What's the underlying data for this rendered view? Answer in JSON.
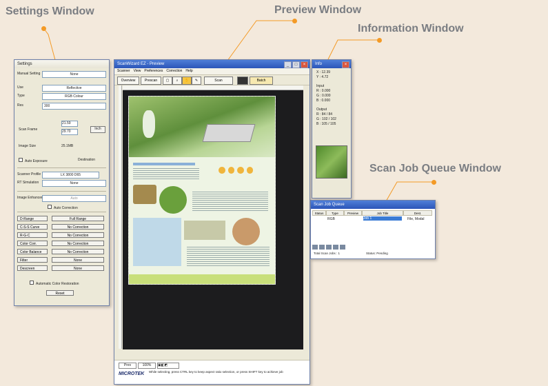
{
  "callouts": {
    "settings": "Settings Window",
    "preview": "Preview Window",
    "information": "Information Window",
    "queue": "Scan Job Queue Window"
  },
  "colors": {
    "accent": "#f39a26",
    "titlebar": "#2b55b8",
    "background": "#f3e9dc"
  },
  "settings_window": {
    "title": "Settings",
    "fields": [
      {
        "label": "Manual Setting",
        "value": "None"
      },
      {
        "label": "Use",
        "value": "Reflective"
      },
      {
        "label": "Type",
        "value": "RGB Colour"
      },
      {
        "label": "Res",
        "value": "300"
      }
    ],
    "scan_frame_label": "Scan Frame",
    "scan_frame_w": "21.59",
    "scan_frame_h": "29.70",
    "unit": "Inch",
    "image_size_label": "Image Size",
    "image_size_value": "25.1MB",
    "auto_exposure": "Auto Exposure",
    "tone_label": "Destination",
    "scanner_profile_label": "Scanner Profile",
    "scanner_profile_value": "LX 3800 D65",
    "rt_simulation": "RT Simulation",
    "rt_value": "None",
    "imagetype_label": "Image Enhancer",
    "imagetype_value": "Auto",
    "auto_correction": "Auto Correction",
    "buttons": [
      {
        "label": "D-Range",
        "value": "Full Range"
      },
      {
        "label": "C-S-S Curve",
        "value": "No Correction"
      },
      {
        "label": "R-G-C",
        "value": "No Correction"
      },
      {
        "label": "Color Corr.",
        "value": "No Correction"
      },
      {
        "label": "Color Balance",
        "value": "No Correction"
      },
      {
        "label": "Filter",
        "value": "None"
      },
      {
        "label": "Descreen",
        "value": "None"
      }
    ],
    "auto_checkbox": "Automatic Color Restoration",
    "reset": "Reset"
  },
  "preview_window": {
    "title": "ScanWizard EZ - Preview",
    "menu": [
      "Scanner",
      "View",
      "Preferences",
      "Correction",
      "Help"
    ],
    "toolbar": {
      "overview": "Overview",
      "prescan": "Prescan",
      "scan": "Scan",
      "batch": "Batch"
    },
    "status_left": "Prev",
    "status_zoom": "100%",
    "status_hint": "While selecting, press CTRL key to keep aspect ratio selection, or press SHIFT key to achieve job",
    "logo": "MICROTEK"
  },
  "info_window": {
    "title": "Info",
    "coords": [
      "X : 12.39",
      "Y : 4.72"
    ],
    "input_label": "Input",
    "input_vals": [
      "R : 0.000",
      "G : 0.000",
      "B : 0.000"
    ],
    "output_label": "Output",
    "output_vals": [
      "R : 84  /  84",
      "G : 102  /  102",
      "B : 105  /  105"
    ]
  },
  "queue_window": {
    "title": "Scan Job Queue",
    "headers": [
      "Status",
      "Type",
      "Preview",
      "Job Title",
      "Dest."
    ],
    "rows": [
      {
        "status": "",
        "type": "RGB",
        "preview": "",
        "title": "Job 1",
        "dest": "File, Modal"
      }
    ],
    "footer_left": "Total Scan Jobs : 1",
    "footer_right": "Status: Pending"
  }
}
